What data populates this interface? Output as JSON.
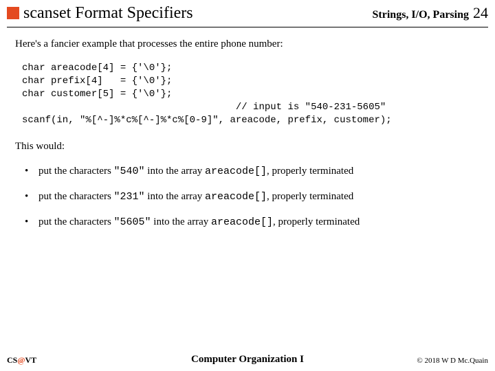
{
  "header": {
    "title": "scanset Format Specifiers",
    "section": "Strings, I/O, Parsing",
    "page_number": "24"
  },
  "intro": "Here's a fancier example that processes the entire phone number:",
  "code": "char areacode[4] = {'\\0'};\nchar prefix[4]   = {'\\0'};\nchar customer[5] = {'\\0'};\n                                     // input is \"540-231-5605\"\nscanf(in, \"%[^-]%*c%[^-]%*c%[0-9]\", areacode, prefix, customer);",
  "explain": "This would:",
  "bullets": [
    {
      "pre": "put the characters ",
      "q1": "\"540\"",
      "mid": " into the array ",
      "arr": "areacode[]",
      "post": ", properly terminated"
    },
    {
      "pre": "put the characters ",
      "q1": "\"231\"",
      "mid": " into the array ",
      "arr": "areacode[]",
      "post": ", properly terminated"
    },
    {
      "pre": "put the characters ",
      "q1": "\"5605\"",
      "mid": " into the array ",
      "arr": "areacode[]",
      "post": ", properly terminated"
    }
  ],
  "footer": {
    "left_cs": "CS",
    "left_at": "@",
    "left_vt": "VT",
    "center": "Computer Organization I",
    "right": "© 2018 W D Mc.Quain"
  }
}
